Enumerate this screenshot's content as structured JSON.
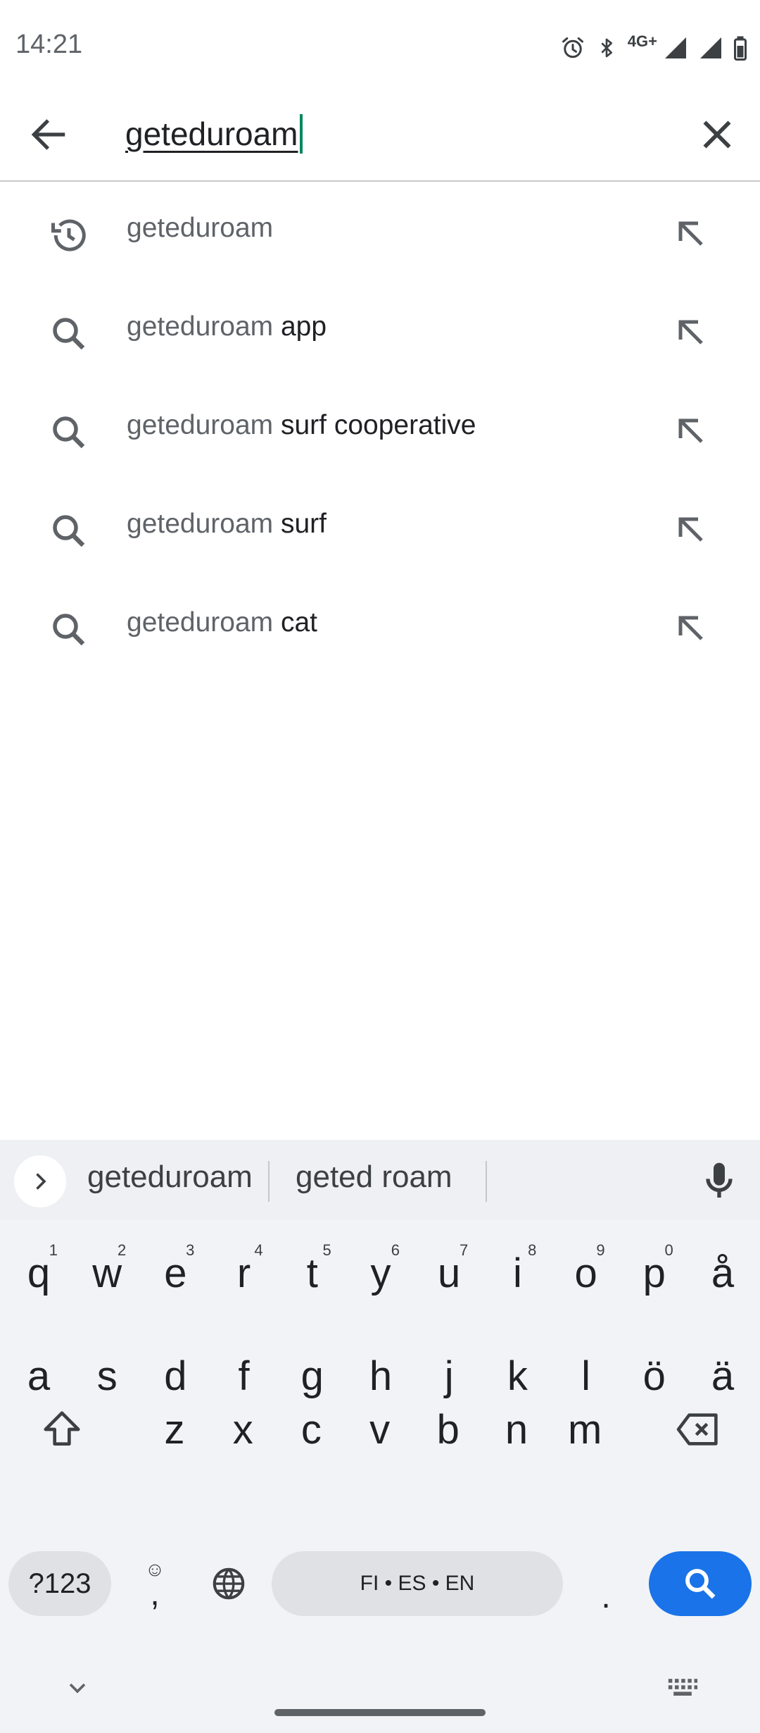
{
  "status": {
    "time": "14:21",
    "network": "4G+",
    "icons": [
      "alarm-icon",
      "bluetooth-icon",
      "signal-icon",
      "signal-icon",
      "battery-icon"
    ]
  },
  "search": {
    "query": "geteduroam",
    "back_icon": "arrow-back-icon",
    "clear_icon": "close-icon"
  },
  "suggestions": [
    {
      "prefix": "geteduroam",
      "rest": "",
      "icon": "history-icon"
    },
    {
      "prefix": "geteduroam",
      "rest": " app",
      "icon": "search-icon"
    },
    {
      "prefix": "geteduroam",
      "rest": " surf cooperative",
      "icon": "search-icon"
    },
    {
      "prefix": "geteduroam",
      "rest": " surf",
      "icon": "search-icon"
    },
    {
      "prefix": "geteduroam",
      "rest": " cat",
      "icon": "search-icon"
    }
  ],
  "keyboard": {
    "candidates": [
      "geteduroam",
      "geted roam"
    ],
    "row1": [
      {
        "k": "q",
        "h": "1"
      },
      {
        "k": "w",
        "h": "2"
      },
      {
        "k": "e",
        "h": "3"
      },
      {
        "k": "r",
        "h": "4"
      },
      {
        "k": "t",
        "h": "5"
      },
      {
        "k": "y",
        "h": "6"
      },
      {
        "k": "u",
        "h": "7"
      },
      {
        "k": "i",
        "h": "8"
      },
      {
        "k": "o",
        "h": "9"
      },
      {
        "k": "p",
        "h": "0"
      },
      {
        "k": "å",
        "h": ""
      }
    ],
    "row2": [
      "a",
      "s",
      "d",
      "f",
      "g",
      "h",
      "j",
      "k",
      "l",
      "ö",
      "ä"
    ],
    "row3": [
      "z",
      "x",
      "c",
      "v",
      "b",
      "n",
      "m"
    ],
    "symbols_label": "?123",
    "comma": ",",
    "period": ".",
    "space_label": "FI • ES • EN",
    "accent_color": "#1a73e8"
  }
}
